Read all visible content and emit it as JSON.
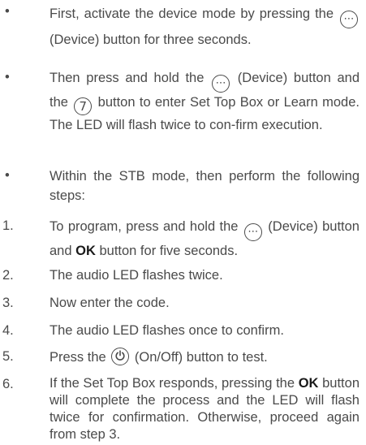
{
  "bullet_symbol": "•",
  "items": [
    {
      "marker": "•",
      "a": "First, activate the device mode by pressing the",
      "b": "(Device) button for three seconds."
    },
    {
      "marker": "•",
      "a": "Then press and hold the",
      "b": "(Device) button and the",
      "c": "button to enter Set Top Box or Learn mode. The LED will flash twice to con-firm execution."
    },
    {
      "marker": "•",
      "a": "Within the STB mode, then perform the following steps:"
    },
    {
      "marker": "1.",
      "a": "To program, press and hold the",
      "b": "(Device) button and",
      "bold": "OK",
      "c": "button for five seconds."
    },
    {
      "marker": "2.",
      "a": "The audio LED flashes twice."
    },
    {
      "marker": "3.",
      "a": "Now enter the code."
    },
    {
      "marker": "4.",
      "a": "The audio LED flashes once to confirm."
    },
    {
      "marker": "5.",
      "a": "Press the",
      "b": "(On/Off) button to test."
    },
    {
      "marker": "6.",
      "a": "If the Set Top Box responds, pressing the",
      "bold": "OK",
      "b": "button will complete the process and the LED will flash twice for confirmation. Otherwise, proceed again from step 3."
    }
  ],
  "icons": {
    "device": "⋯",
    "seven": "7",
    "power": "power-icon",
    "device_name": "device-icon",
    "seven_name": "seven-key-icon"
  }
}
